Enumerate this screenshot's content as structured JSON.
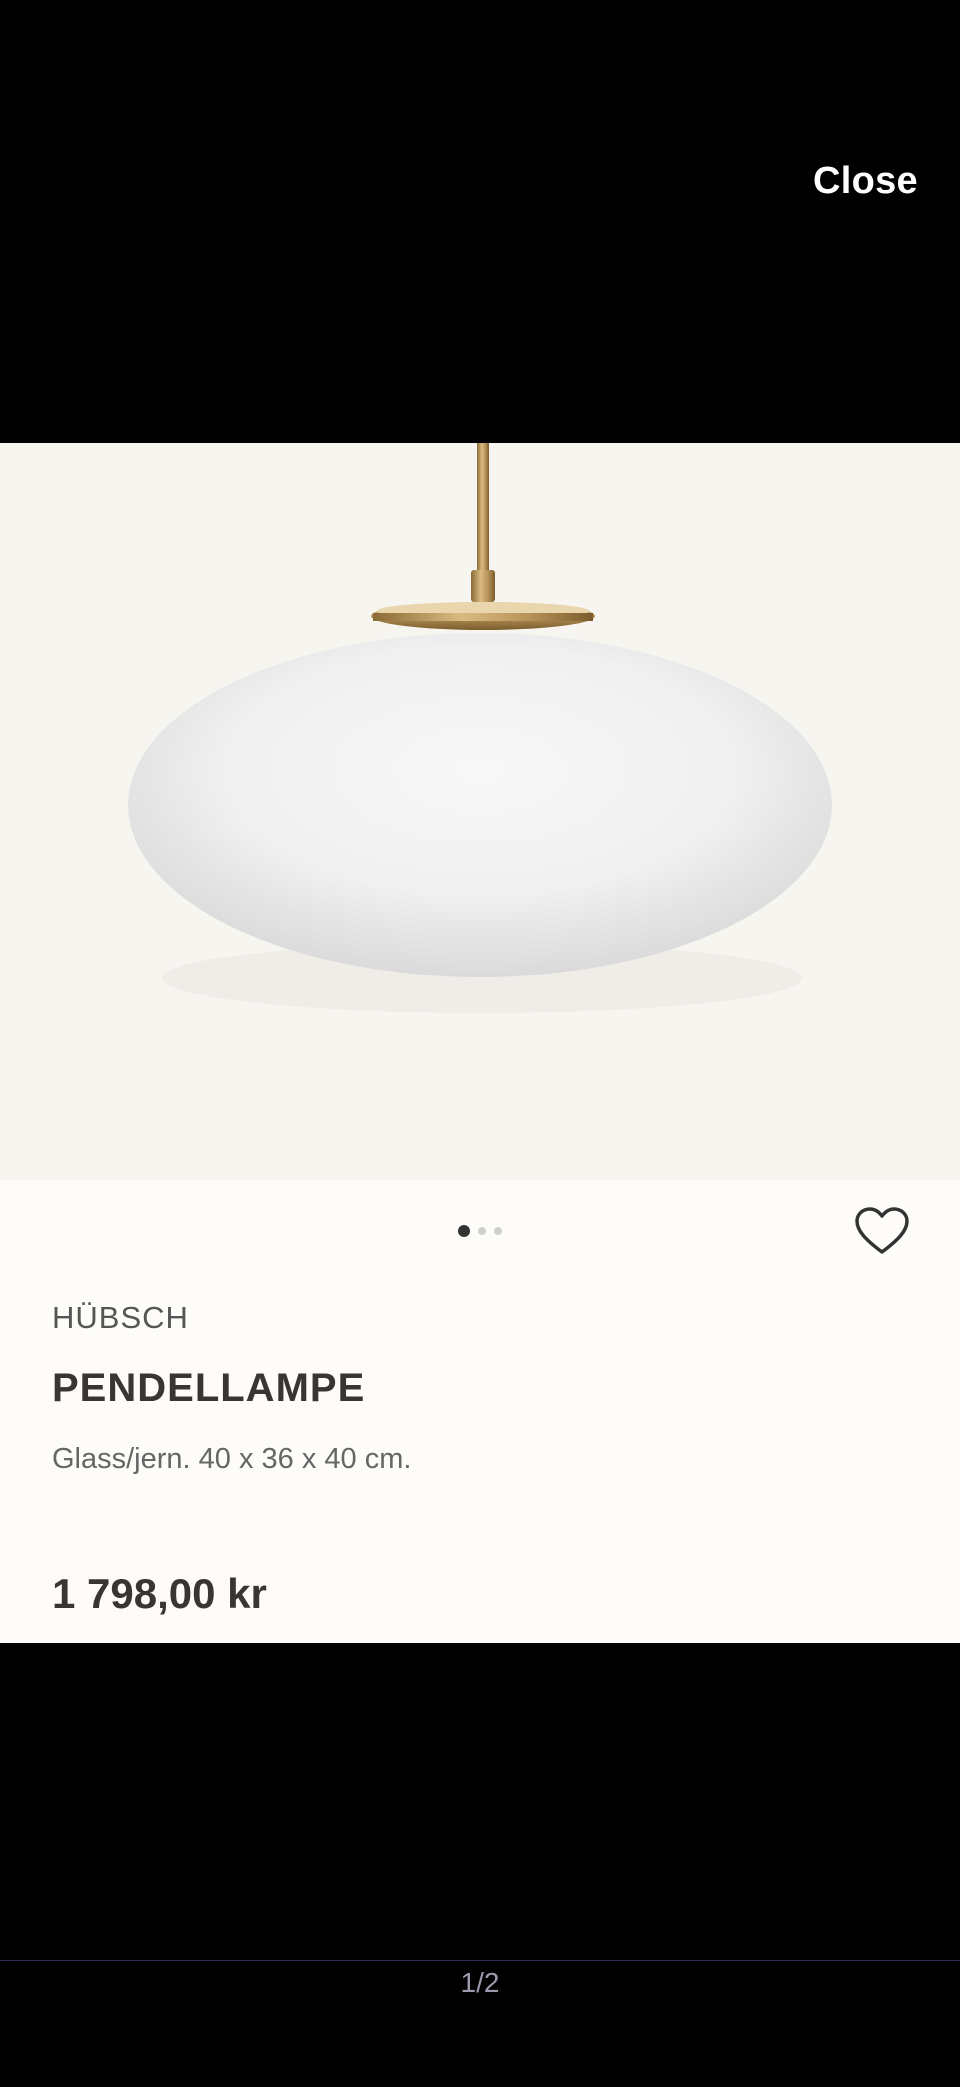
{
  "viewer": {
    "close_label": "Close",
    "page_indicator": "1/2"
  },
  "product": {
    "image_alt_icon": "pendant-lamp-image",
    "brand": "HÜBSCH",
    "title": "PENDELLAMPE",
    "description": "Glass/jern. 40 x 36 x 40 cm.",
    "price": "1 798,00 kr",
    "favorite_icon": "heart-icon",
    "image_dots": {
      "count": 3,
      "active_index": 0
    }
  },
  "colors": {
    "background": "#000000",
    "card": "#fdfcf9",
    "image_bg": "#f7f5f0",
    "text_dark": "#3a3533",
    "brass": "#b8945a"
  }
}
